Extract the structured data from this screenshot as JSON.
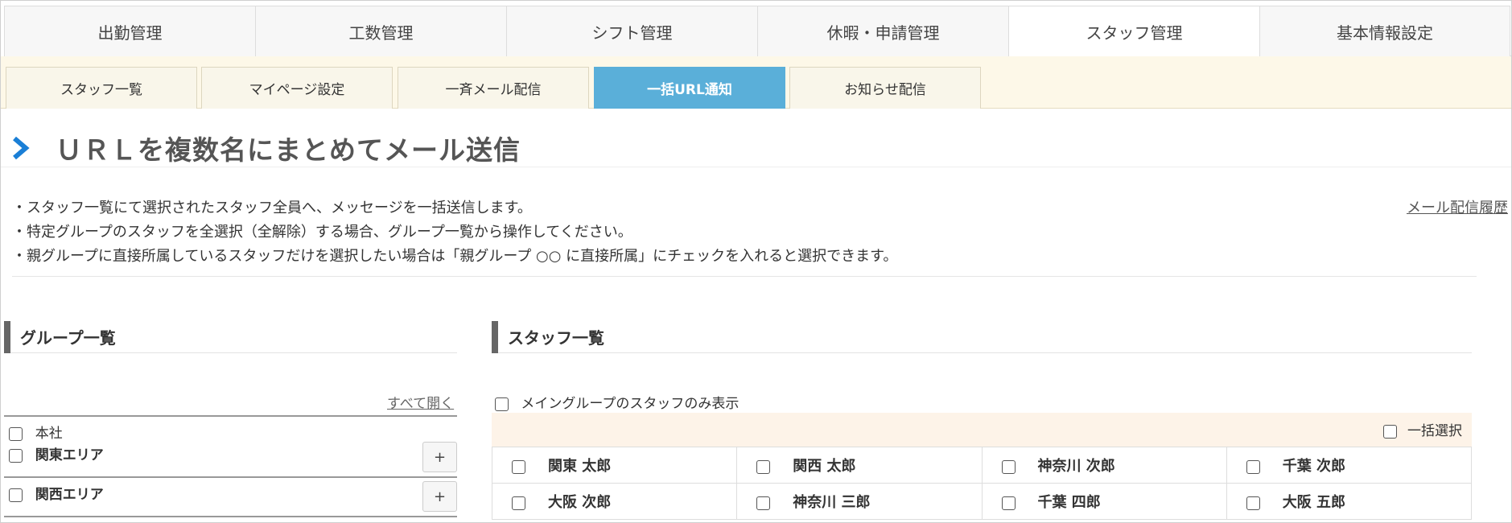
{
  "main_tabs": [
    "出勤管理",
    "工数管理",
    "シフト管理",
    "休暇・申請管理",
    "スタッフ管理",
    "基本情報設定"
  ],
  "sub_tabs": [
    "スタッフ一覧",
    "マイページ設定",
    "一斉メール配信",
    "一括URL通知",
    "お知らせ配信"
  ],
  "page_title": "ＵＲＬを複数名にまとめてメール送信",
  "instructions": [
    "・スタッフ一覧にて選択されたスタッフ全員へ、メッセージを一括送信します。",
    "・特定グループのスタッフを全選択（全解除）する場合、グループ一覧から操作してください。",
    "・親グループに直接所属しているスタッフだけを選択したい場合は「親グループ ○○ に直接所属」にチェックを入れると選択できます。"
  ],
  "history_link": "メール配信履歴",
  "group_section": {
    "title": "グループ一覧",
    "open_all": "すべて開く",
    "root": "本社",
    "groups": [
      {
        "label": "関東エリア",
        "button": "+"
      },
      {
        "label": "関西エリア",
        "button": "+"
      }
    ]
  },
  "staff_section": {
    "title": "スタッフ一覧",
    "main_only": "メイングループのスタッフのみ表示",
    "bulk_select": "一括選択",
    "rows": [
      [
        "関東 太郎",
        "関西 太郎",
        "神奈川 次郎",
        "千葉 次郎"
      ],
      [
        "大阪 次郎",
        "神奈川 三郎",
        "千葉 四郎",
        "大阪 五郎"
      ]
    ]
  }
}
